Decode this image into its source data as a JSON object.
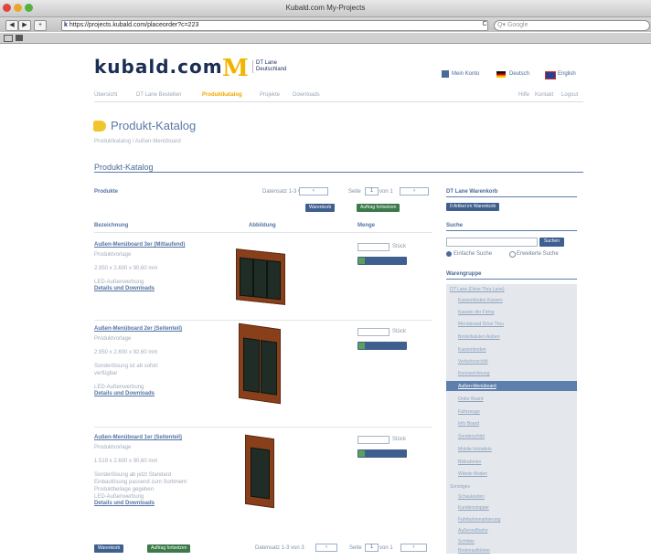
{
  "window": {
    "title": "Kubald.com My-Projects",
    "url": "https://projects.kubald.com/placeorder?c=223",
    "search_placeholder": "Q▾ Google",
    "back": "◀",
    "forward": "▶",
    "add": "+",
    "reload": "C"
  },
  "header": {
    "logo": "kubald.com",
    "brand_mark": "M",
    "brand_line1": "DT Lane",
    "brand_line2": "Deutschland",
    "account": "Mein Konto",
    "lang_de": "Deutsch",
    "lang_en": "English"
  },
  "nav": {
    "left": [
      "Übersicht",
      "DT Lane Bestellen",
      "Produktkatalog",
      "Projekte",
      "Downloads"
    ],
    "right": [
      "Hilfe",
      "Kontakt",
      "Logout"
    ]
  },
  "page": {
    "title": "Produkt-Katalog",
    "breadcrumb": "Produktkatalog / Außen-Menüboard",
    "section": "Produkt-Katalog"
  },
  "catalog": {
    "label": "Produkte",
    "pager": "Datensatz 1-3 von 3",
    "page_label": "Seite",
    "page_value": "1",
    "page_of": "von 1",
    "prev": "‹",
    "next": "›",
    "print_button": "Warenkorb",
    "order_button": "Auftrag fortsetzen",
    "columns": [
      "Bezeichnung",
      "Abbildung",
      "Menge"
    ],
    "unit": "Stück",
    "add_label": "Hinzufügen",
    "details_link": "Details und Downloads"
  },
  "products": [
    {
      "name": "Außen-Menüboard 3er (Mitlaufend)",
      "lines": [
        "Produktvorlage",
        "2.950 x 2.600 x 90,60 mm",
        "LED-Außenwerbung"
      ]
    },
    {
      "name": "Außen-Menüboard 2er (Seitenteil)",
      "lines": [
        "Produktvorlage",
        "2.950 x 2.600 x 92,60 mm",
        "Sonderlösung ist ab sofort",
        "verfügbar",
        "LED-Außenwerbung"
      ]
    },
    {
      "name": "Außen-Menüboard 1er (Seitenteil)",
      "lines": [
        "Produktvorlage",
        "1.519 x 2.600 x 90,60 mm",
        "Sonderlösung ab jetzt Standard",
        "Einbaulösung passend zum Sortiment",
        "Produktbeilage gegeben",
        "LED-Außenwerbung"
      ]
    }
  ],
  "sidebar": {
    "basket_title": "DT Lane Warenkorb",
    "basket_button": "0 Artikel im Warenkorb",
    "search_title": "Suche",
    "search_button": "Suchen",
    "search_opt1": "Einfache Suche",
    "search_opt2": "Erweiterte Suche",
    "groups_title": "Warengruppe",
    "group_head": "DT Lane (Drive Thru Lane)",
    "items": [
      "Kassenboden Kassen",
      "Kassen der Firma",
      "Menüboard Drive Thru",
      "Bestellsäulen Außen",
      "Kassenboden",
      "Verkehrsschild",
      "Kennzeichnung",
      "Außen-Menüboard",
      "Order Board",
      "Fahrzeuge",
      "Info Board",
      "Sonderschild",
      "Mobile Infotafeln",
      "Bildrahmen",
      "Wände-Boden"
    ],
    "selected_index": 7,
    "other_head": "Sonstiges",
    "other_items": [
      "Schaukästen",
      "Kundenstopper",
      "Fahrbahnmarkierung",
      "Außenrollbahn",
      "Schilder",
      "Bodenaufkleber",
      "Beleuchtung"
    ]
  }
}
